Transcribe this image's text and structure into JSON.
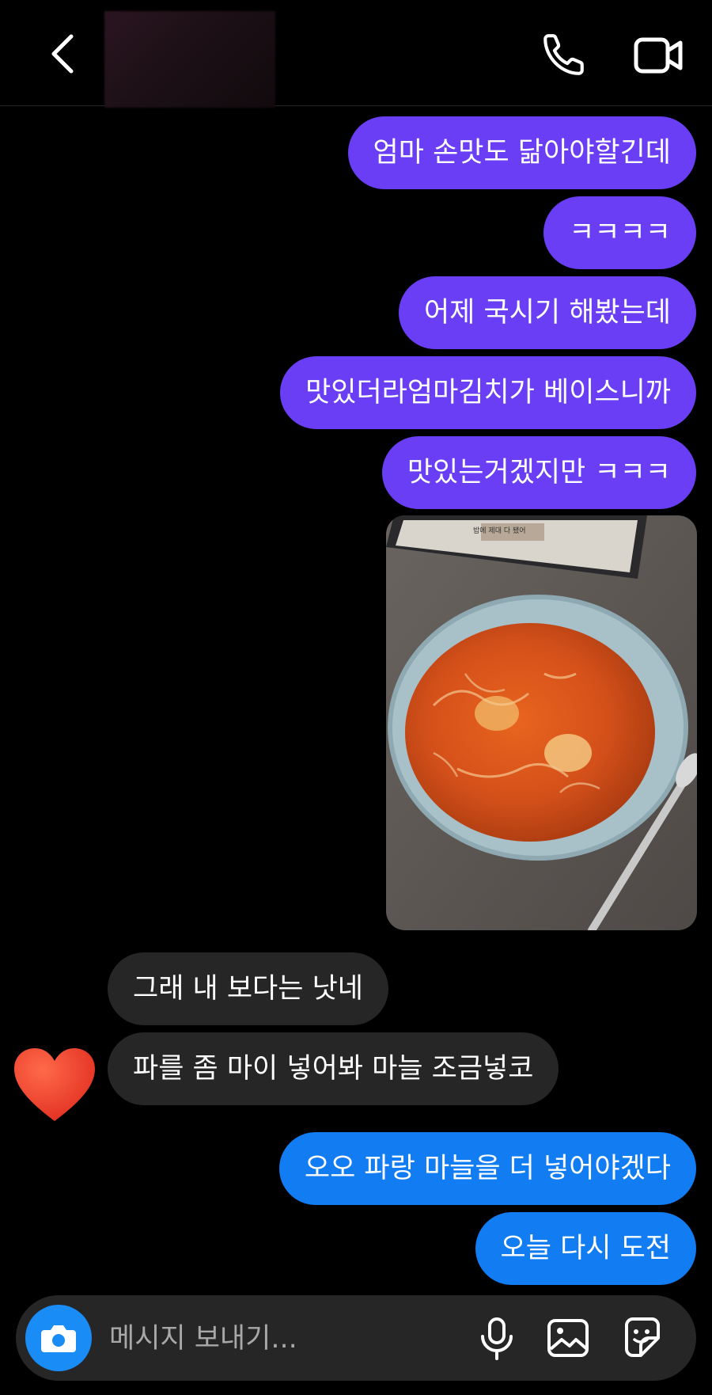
{
  "header": {
    "contact_name": "",
    "back_icon": "chevron-left-icon",
    "call_icon": "phone-icon",
    "video_icon": "video-camera-icon"
  },
  "messages": [
    {
      "sender": "me",
      "text": "엄마 손맛도 닮아야할긴데"
    },
    {
      "sender": "me",
      "text": "ㅋㅋㅋㅋ"
    },
    {
      "sender": "me",
      "text": "어제 국시기 해봤는데"
    },
    {
      "sender": "me",
      "text": "맛있더라엄마김치가 베이스니까"
    },
    {
      "sender": "me",
      "text": "맛있는거겠지만 ㅋㅋㅋ"
    },
    {
      "sender": "me",
      "type": "photo",
      "caption": "밥에 제대 다 됐어"
    },
    {
      "sender": "them",
      "text": "그래 내 보다는 낫네"
    },
    {
      "sender": "them",
      "text": "파를 좀 마이 넣어봐 마늘  조금넣코",
      "reaction": "heart"
    },
    {
      "sender": "me",
      "text": "오오 파랑 마늘을 더 넣어야겠다"
    },
    {
      "sender": "me",
      "text": "오늘 다시 도전"
    }
  ],
  "composer": {
    "placeholder": "메시지 보내기...",
    "camera_icon": "camera-icon",
    "mic_icon": "microphone-icon",
    "gallery_icon": "image-icon",
    "sticker_icon": "sticker-icon"
  },
  "colors": {
    "sent_purple": "#6a3ef4",
    "sent_blue": "#127cf2",
    "received": "#262626",
    "background": "#000000",
    "camera_button": "#1a8cf5"
  }
}
